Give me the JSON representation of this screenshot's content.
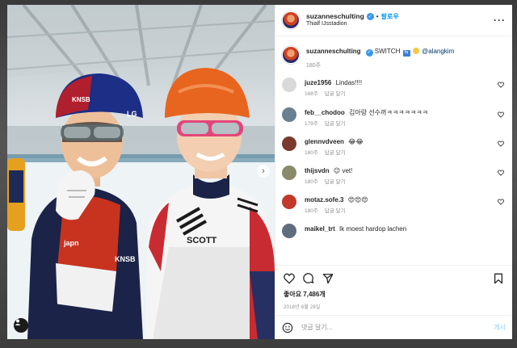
{
  "header": {
    "username": "suzanneschulting",
    "separator": "•",
    "follow_label": "팔로우",
    "location": "Thialf IJsstadion",
    "more_icon": "more-horizontal-icon"
  },
  "caption": {
    "username": "suzanneschulting",
    "text_before": "SWITCH",
    "switch_icon": "arrows-switch-emoji",
    "emoji": "grinning-face-emoji",
    "mention": "@alangkim",
    "time": "180주"
  },
  "comments": [
    {
      "user": "juze1956",
      "text": "Lindas!!!!",
      "time": "168주",
      "likes_label": "답글 달기",
      "avatar_color": "#d9d9d9"
    },
    {
      "user": "feb__chodoo",
      "text": "김아랑 선수꺼ㅋㅋㅋㅋㅋㅋㅋ",
      "time": "179주",
      "likes_label": "답글 달기",
      "avatar_color": "#6a7f8f"
    },
    {
      "user": "glennvdveen",
      "text": "😂😂",
      "time": "180주",
      "likes_label": "답글 달기",
      "avatar_color": "#7a3b2e"
    },
    {
      "user": "thijsvdn",
      "text": "😉 vet!",
      "time": "180주",
      "likes_label": "답글 달기",
      "avatar_color": "#8a8a6a"
    },
    {
      "user": "motaz.sofe.3",
      "text": "😍😍😍",
      "time": "180주",
      "likes_label": "답글 달기",
      "avatar_color": "#c0392b"
    },
    {
      "user": "maikel_trt",
      "text": "Ik moest hardop lachen",
      "time": "",
      "likes_label": "",
      "avatar_color": "#5d6d7e"
    }
  ],
  "actions": {
    "like_icon": "heart-icon",
    "comment_icon": "comment-icon",
    "share_icon": "send-icon",
    "save_icon": "bookmark-icon",
    "likes_text": "좋아요 7,486개",
    "date": "2018년 8월 29일"
  },
  "add_comment": {
    "placeholder": "댓글 달기...",
    "post_label": "게시"
  },
  "colors": {
    "link_blue": "#0095f6",
    "muted": "#8e8e8e",
    "helmet_left": "#b01f2e",
    "helmet_right": "#e8651f"
  }
}
